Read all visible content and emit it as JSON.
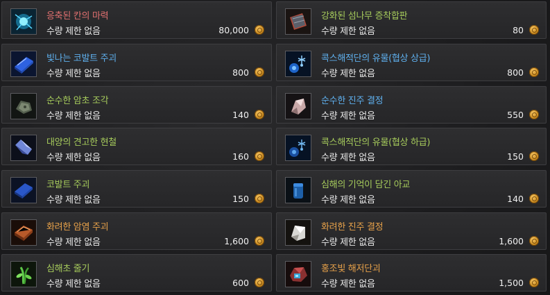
{
  "colors": {
    "tier_red": "#e07070",
    "tier_blue": "#5fb0ee",
    "tier_green": "#a7cc5c",
    "tier_orange": "#e8a24a"
  },
  "limit_label": "수량 제한 없음",
  "items": [
    {
      "name": "응축된 칸의 마력",
      "price": "80,000",
      "tier": "red",
      "icon": "blue-orb-icon"
    },
    {
      "name": "강화된 섬나무 증착합판",
      "price": "80",
      "tier": "green",
      "icon": "wood-plank-icon"
    },
    {
      "name": "빛나는 코발트 주괴",
      "price": "800",
      "tier": "blue",
      "icon": "glowing-cobalt-ingot-icon"
    },
    {
      "name": "콕스해적단의 유물(협상 상급)",
      "price": "800",
      "tier": "blue",
      "icon": "pirate-relic-icon"
    },
    {
      "name": "순수한 암초 조각",
      "price": "140",
      "tier": "green",
      "icon": "reef-fragment-icon"
    },
    {
      "name": "순수한 진주 결정",
      "price": "550",
      "tier": "blue",
      "icon": "pearl-crystal-icon"
    },
    {
      "name": "대양의 견고한 현철",
      "price": "160",
      "tier": "green",
      "icon": "ocean-crystal-icon"
    },
    {
      "name": "콕스해적단의 유물(협상 하급)",
      "price": "150",
      "tier": "green",
      "icon": "pirate-relic-lower-icon"
    },
    {
      "name": "코발트 주괴",
      "price": "150",
      "tier": "green",
      "icon": "cobalt-ingot-icon"
    },
    {
      "name": "심해의 기억이 담긴 아교",
      "price": "140",
      "tier": "green",
      "icon": "glue-jar-icon"
    },
    {
      "name": "화려한 암염 주괴",
      "price": "1,600",
      "tier": "orange",
      "icon": "rock-salt-ingot-icon"
    },
    {
      "name": "화려한 진주 결정",
      "price": "1,600",
      "tier": "orange",
      "icon": "brilliant-pearl-icon"
    },
    {
      "name": "심해초 줄기",
      "price": "600",
      "tier": "green",
      "icon": "seaweed-stem-icon"
    },
    {
      "name": "홍조빛 해저단괴",
      "price": "1,500",
      "tier": "orange",
      "icon": "red-nodule-icon"
    }
  ]
}
